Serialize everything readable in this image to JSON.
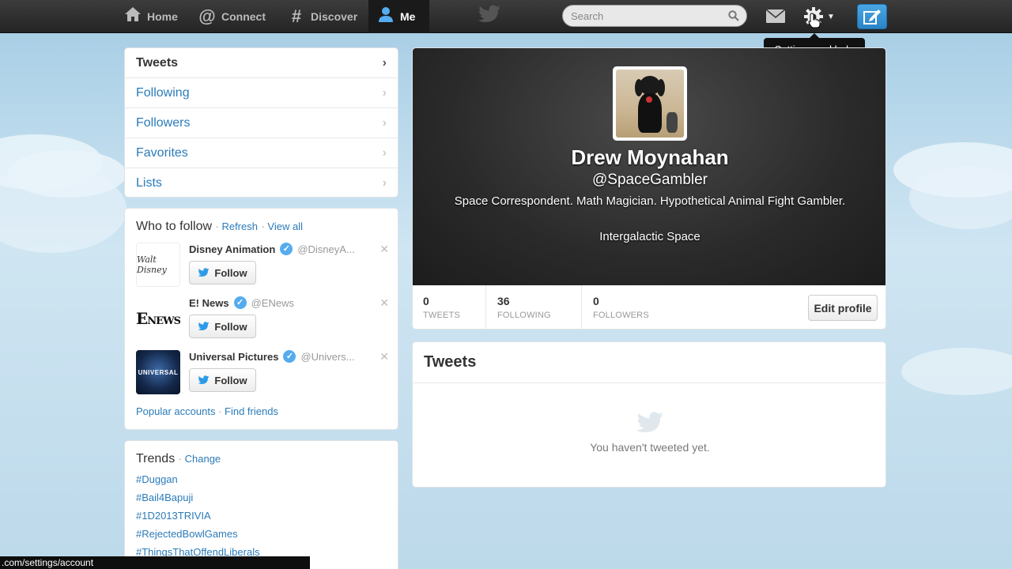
{
  "topnav": {
    "items": [
      {
        "label": "Home",
        "icon": "home-icon"
      },
      {
        "label": "Connect",
        "icon": "at-icon"
      },
      {
        "label": "Discover",
        "icon": "hash-icon"
      },
      {
        "label": "Me",
        "icon": "user-icon"
      }
    ],
    "search_placeholder": "Search",
    "tooltip": "Settings and help"
  },
  "sidebar_nav": {
    "items": [
      "Tweets",
      "Following",
      "Followers",
      "Favorites",
      "Lists"
    ]
  },
  "who_to_follow": {
    "title": "Who to follow",
    "refresh": "Refresh",
    "view_all": "View all",
    "follow_label": "Follow",
    "suggestions": [
      {
        "name": "Disney Animation",
        "handle": "@DisneyA..."
      },
      {
        "name": "E! News",
        "handle": "@ENews"
      },
      {
        "name": "Universal Pictures",
        "handle": "@Univers..."
      }
    ],
    "popular_accounts": "Popular accounts",
    "find_friends": "Find friends"
  },
  "trends": {
    "title": "Trends",
    "change": "Change",
    "items": [
      "#Duggan",
      "#Bail4Bapuji",
      "#1D2013TRIVIA",
      "#RejectedBowlGames",
      "#ThingsThatOffendLiberals"
    ]
  },
  "profile": {
    "name": "Drew Moynahan",
    "handle": "@SpaceGambler",
    "bio": "Space Correspondent. Math Magician. Hypothetical Animal Fight Gambler.",
    "location": "Intergalactic Space",
    "stats": [
      {
        "num": "0",
        "label": "TWEETS"
      },
      {
        "num": "36",
        "label": "FOLLOWING"
      },
      {
        "num": "0",
        "label": "FOLLOWERS"
      }
    ],
    "edit_label": "Edit profile"
  },
  "tweets": {
    "title": "Tweets",
    "empty": "You haven't tweeted yet."
  },
  "status_url": ".com/settings/account",
  "colors": {
    "link": "#2b7bb9",
    "topbar": "#2e2e2e",
    "compose": "#3b95d8",
    "verified": "#55acee"
  }
}
